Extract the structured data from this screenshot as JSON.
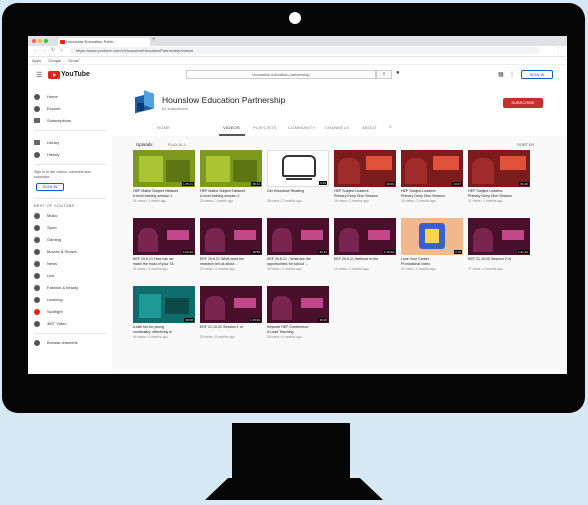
{
  "browser": {
    "tab_title": "Hounslow Education Partn...",
    "url": "https://www.youtube.com/c/HounslowEducationPartnership/videos",
    "bookmarks": [
      "Apps",
      "Google",
      "Gmail"
    ]
  },
  "youtube": {
    "logo_text": "YouTube",
    "search_placeholder": "Hounslow education partnership",
    "signin_label": "SIGN IN"
  },
  "sidebar": {
    "items": [
      {
        "label": "Home",
        "icon": "home-icon"
      },
      {
        "label": "Explore",
        "icon": "compass-icon"
      },
      {
        "label": "Subscriptions",
        "icon": "subscriptions-icon"
      },
      {
        "label": "Library",
        "icon": "library-icon"
      },
      {
        "label": "History",
        "icon": "history-icon"
      }
    ],
    "signin_message": "Sign in to like videos, comment and subscribe.",
    "signin_label": "SIGN IN",
    "best_heading": "BEST OF YOUTUBE",
    "best_items": [
      "Music",
      "Sport",
      "Gaming",
      "Movies & Shows",
      "News",
      "Live",
      "Fashion & beauty",
      "Learning",
      "Spotlight",
      "360° Video"
    ],
    "browse_label": "Browse channels"
  },
  "channel": {
    "name": "Hounslow Education Partnership",
    "subscribers": "81 subscribers",
    "subscribe_label": "SUBSCRIBE",
    "tabs": [
      "HOME",
      "VIDEOS",
      "PLAYLISTS",
      "COMMUNITY",
      "CHANNELS",
      "ABOUT"
    ],
    "active_tab": "VIDEOS",
    "section_title": "Uploads",
    "play_all": "PLAY ALL",
    "sort_by": "SORT BY"
  },
  "videos": [
    {
      "title": "HEP Maths Subject Network",
      "title2": "A level training session 1",
      "meta": "31 views • 1 month ago",
      "duration": "1:05:21",
      "thumb": "green"
    },
    {
      "title": "HEP Maths Subject Network",
      "title2": "A level training session 2",
      "meta": "25 views • 1 month ago",
      "duration": "58:12",
      "thumb": "green"
    },
    {
      "title": "Get Hounslow Reading",
      "title2": "",
      "meta": "36 views • 2 months ago",
      "duration": "3:24",
      "thumb": "white"
    },
    {
      "title": "HEP Subject Leaders:",
      "title2": "Primary Deep Dive Session",
      "meta": "24 views • 2 months ago",
      "duration": "46:03",
      "thumb": "red"
    },
    {
      "title": "HEP Subject Leaders:",
      "title2": "Primary Deep Dive Session",
      "meta": "18 views • 2 months ago",
      "duration": "44:17",
      "thumb": "red"
    },
    {
      "title": "HEP Subject Leaders:",
      "title2": "Primary Deep Dive Session",
      "meta": "21 views • 2 months ago",
      "duration": "51:40",
      "thumb": "red"
    },
    {
      "title": "EEF 29.6.21 How can we",
      "title2": "make the most of your TA",
      "meta": "41 views • 3 months ago",
      "duration": "1:02:10",
      "thumb": "purple"
    },
    {
      "title": "EEF 29.6.21 What does the",
      "title2": "research tell us about ...",
      "meta": "33 views • 3 months ago",
      "duration": "48:55",
      "thumb": "purple"
    },
    {
      "title": "EEF 29.6.21 - What are the",
      "title2": "opportunities for school ...",
      "meta": "29 views • 3 months ago",
      "duration": "52:31",
      "thumb": "purple"
    },
    {
      "title": "EEF 29.6.21 Webinar to the",
      "title2": "",
      "meta": "19 views • 3 months ago",
      "duration": "1:10:02",
      "thumb": "purple"
    },
    {
      "title": "Love Your Career -",
      "title2": "Promotional video",
      "meta": "52 views • 4 months ago",
      "duration": "2:15",
      "thumb": "peach"
    },
    {
      "title": "EEF 21.10.20 Session 2 of",
      "title2": "",
      "meta": "27 views • 4 months ago",
      "duration": "1:21:44",
      "thumb": "purple"
    },
    {
      "title": "A tale fun for young",
      "title2": "vocabulary: effectively in",
      "meta": "44 views • 5 months ago",
      "duration": "39:08",
      "thumb": "teal"
    },
    {
      "title": "EEF 21.10.20 Session 1 of",
      "title2": "",
      "meta": "30 views • 5 months ago",
      "duration": "1:15:30",
      "thumb": "purple"
    },
    {
      "title": "Keynote HEP Conference:",
      "title2": "A Lead Teaching",
      "meta": "38 views • 6 months ago",
      "duration": "45:16",
      "thumb": "purple"
    }
  ]
}
